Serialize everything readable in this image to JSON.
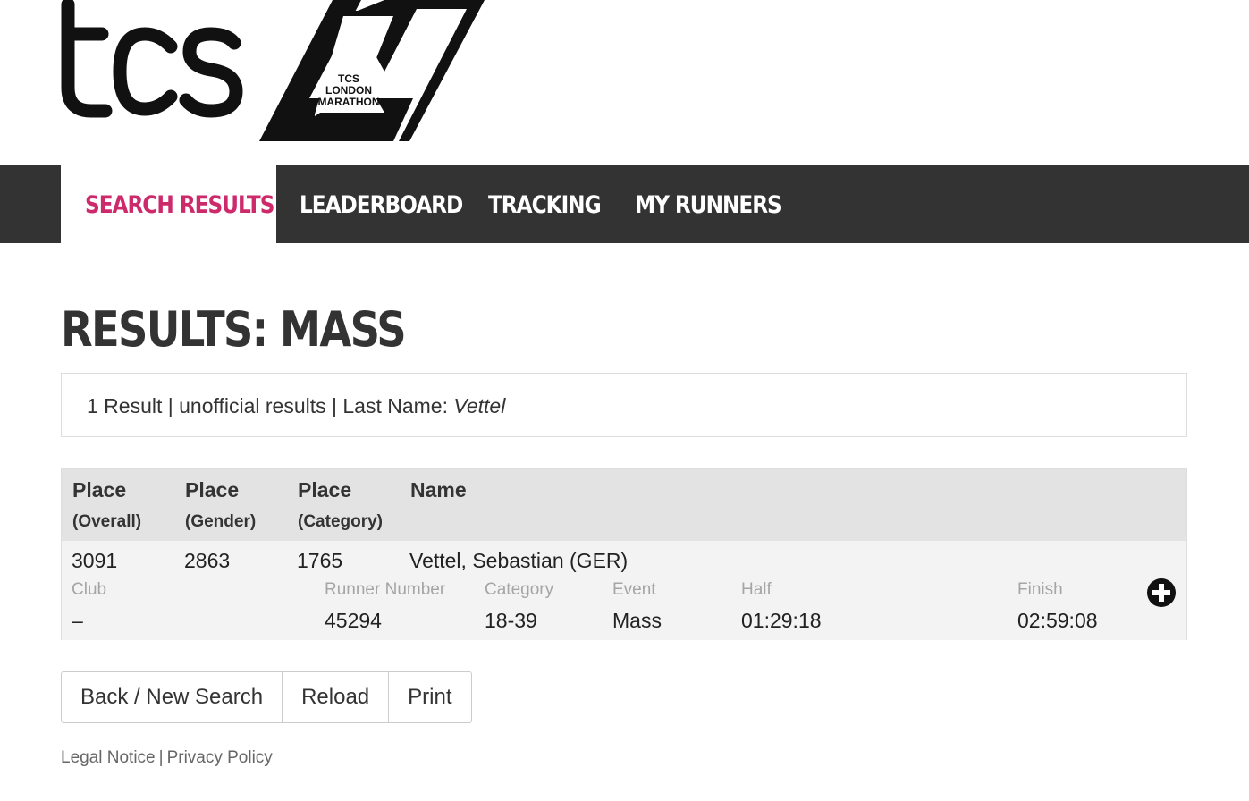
{
  "brand": {
    "tcs_logo_text": "tcs",
    "marathon_logo_text": [
      "TCS",
      "LONDON",
      "MARATHON"
    ]
  },
  "nav": {
    "items": [
      {
        "label": "SEARCH RESULTS",
        "active": true
      },
      {
        "label": "LEADERBOARD",
        "active": false
      },
      {
        "label": "TRACKING",
        "active": false
      },
      {
        "label": "MY RUNNERS",
        "active": false
      }
    ]
  },
  "page": {
    "title": "RESULTS: MASS"
  },
  "summary": {
    "prefix": "1 Result | unofficial results | Last Name: ",
    "last_name": "Vettel"
  },
  "table": {
    "headers": [
      {
        "main": "Place",
        "sub": "(Overall)"
      },
      {
        "main": "Place",
        "sub": "(Gender)"
      },
      {
        "main": "Place",
        "sub": "(Category)"
      },
      {
        "main": "Name",
        "sub": ""
      }
    ],
    "rows": [
      {
        "place_overall": "3091",
        "place_gender": "2863",
        "place_category": "1765",
        "name": "Vettel, Sebastian (GER)",
        "details": {
          "club_label": "Club",
          "club_value": "–",
          "runner_number_label": "Runner Number",
          "runner_number_value": "45294",
          "category_label": "Category",
          "category_value": "18-39",
          "event_label": "Event",
          "event_value": "Mass",
          "half_label": "Half",
          "half_value": "01:29:18",
          "finish_label": "Finish",
          "finish_value": "02:59:08"
        },
        "expand_icon": "plus-circle-icon"
      }
    ]
  },
  "actions": {
    "back_label": "Back / New Search",
    "reload_label": "Reload",
    "print_label": "Print"
  },
  "footer": {
    "legal_label": "Legal Notice",
    "separator": "|",
    "privacy_label": "Privacy Policy"
  },
  "colors": {
    "nav_bg": "#333333",
    "active_nav": "#cc2a6b",
    "header_bg": "#e3e3e3",
    "row_bg": "#f3f3f3"
  }
}
